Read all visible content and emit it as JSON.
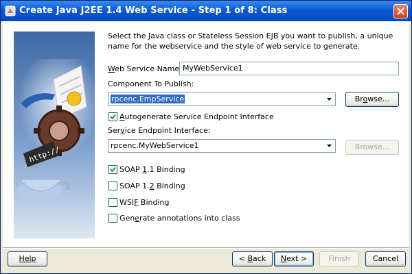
{
  "window": {
    "title": "Create Java J2EE 1.4 Web Service - Step 1 of 8: Class"
  },
  "description": "Select the Java class or Stateless Session EJB you want to publish, a unique name for the webservice and the style of web service to generate.",
  "fields": {
    "web_service_name": {
      "label_key": "W",
      "label_rest": "eb Service Name:",
      "value": "MyWebService1"
    },
    "component_label": "Component To Publish:",
    "component_value": "rpcenc.EmpService",
    "autogenerate": {
      "label_pre": "A",
      "label_rest": "utogenerate Service Endpoint Interface",
      "checked": true
    },
    "sei_label_pre": "Ser",
    "sei_label_key": "v",
    "sei_label_rest": "ice Endpoint Interface:",
    "sei_value": "rpcenc.MyWebService1"
  },
  "options": [
    {
      "pre": "SOAP ",
      "key": "1",
      "rest": ".1 Binding",
      "checked": true
    },
    {
      "pre": "SOAP 1.",
      "key": "2",
      "rest": " Binding",
      "checked": false
    },
    {
      "pre": "WSI",
      "key": "F",
      "rest": " Binding",
      "checked": false
    },
    {
      "pre": "Gen",
      "key": "e",
      "rest": "rate annotations into class",
      "checked": false
    }
  ],
  "buttons": {
    "browse": {
      "pre": "Br",
      "key": "o",
      "rest": "wse..."
    },
    "browse2": "Browse...",
    "help": "Help",
    "back": {
      "pre": "< ",
      "key": "B",
      "rest": "ack"
    },
    "next": {
      "pre": "",
      "key": "N",
      "rest": "ext >"
    },
    "finish": "Finish",
    "cancel": "Cancel"
  },
  "colors": {
    "titlebar": "#0a5bd6",
    "selection": "#316ac5",
    "dialog_bg": "#ece9d8"
  }
}
